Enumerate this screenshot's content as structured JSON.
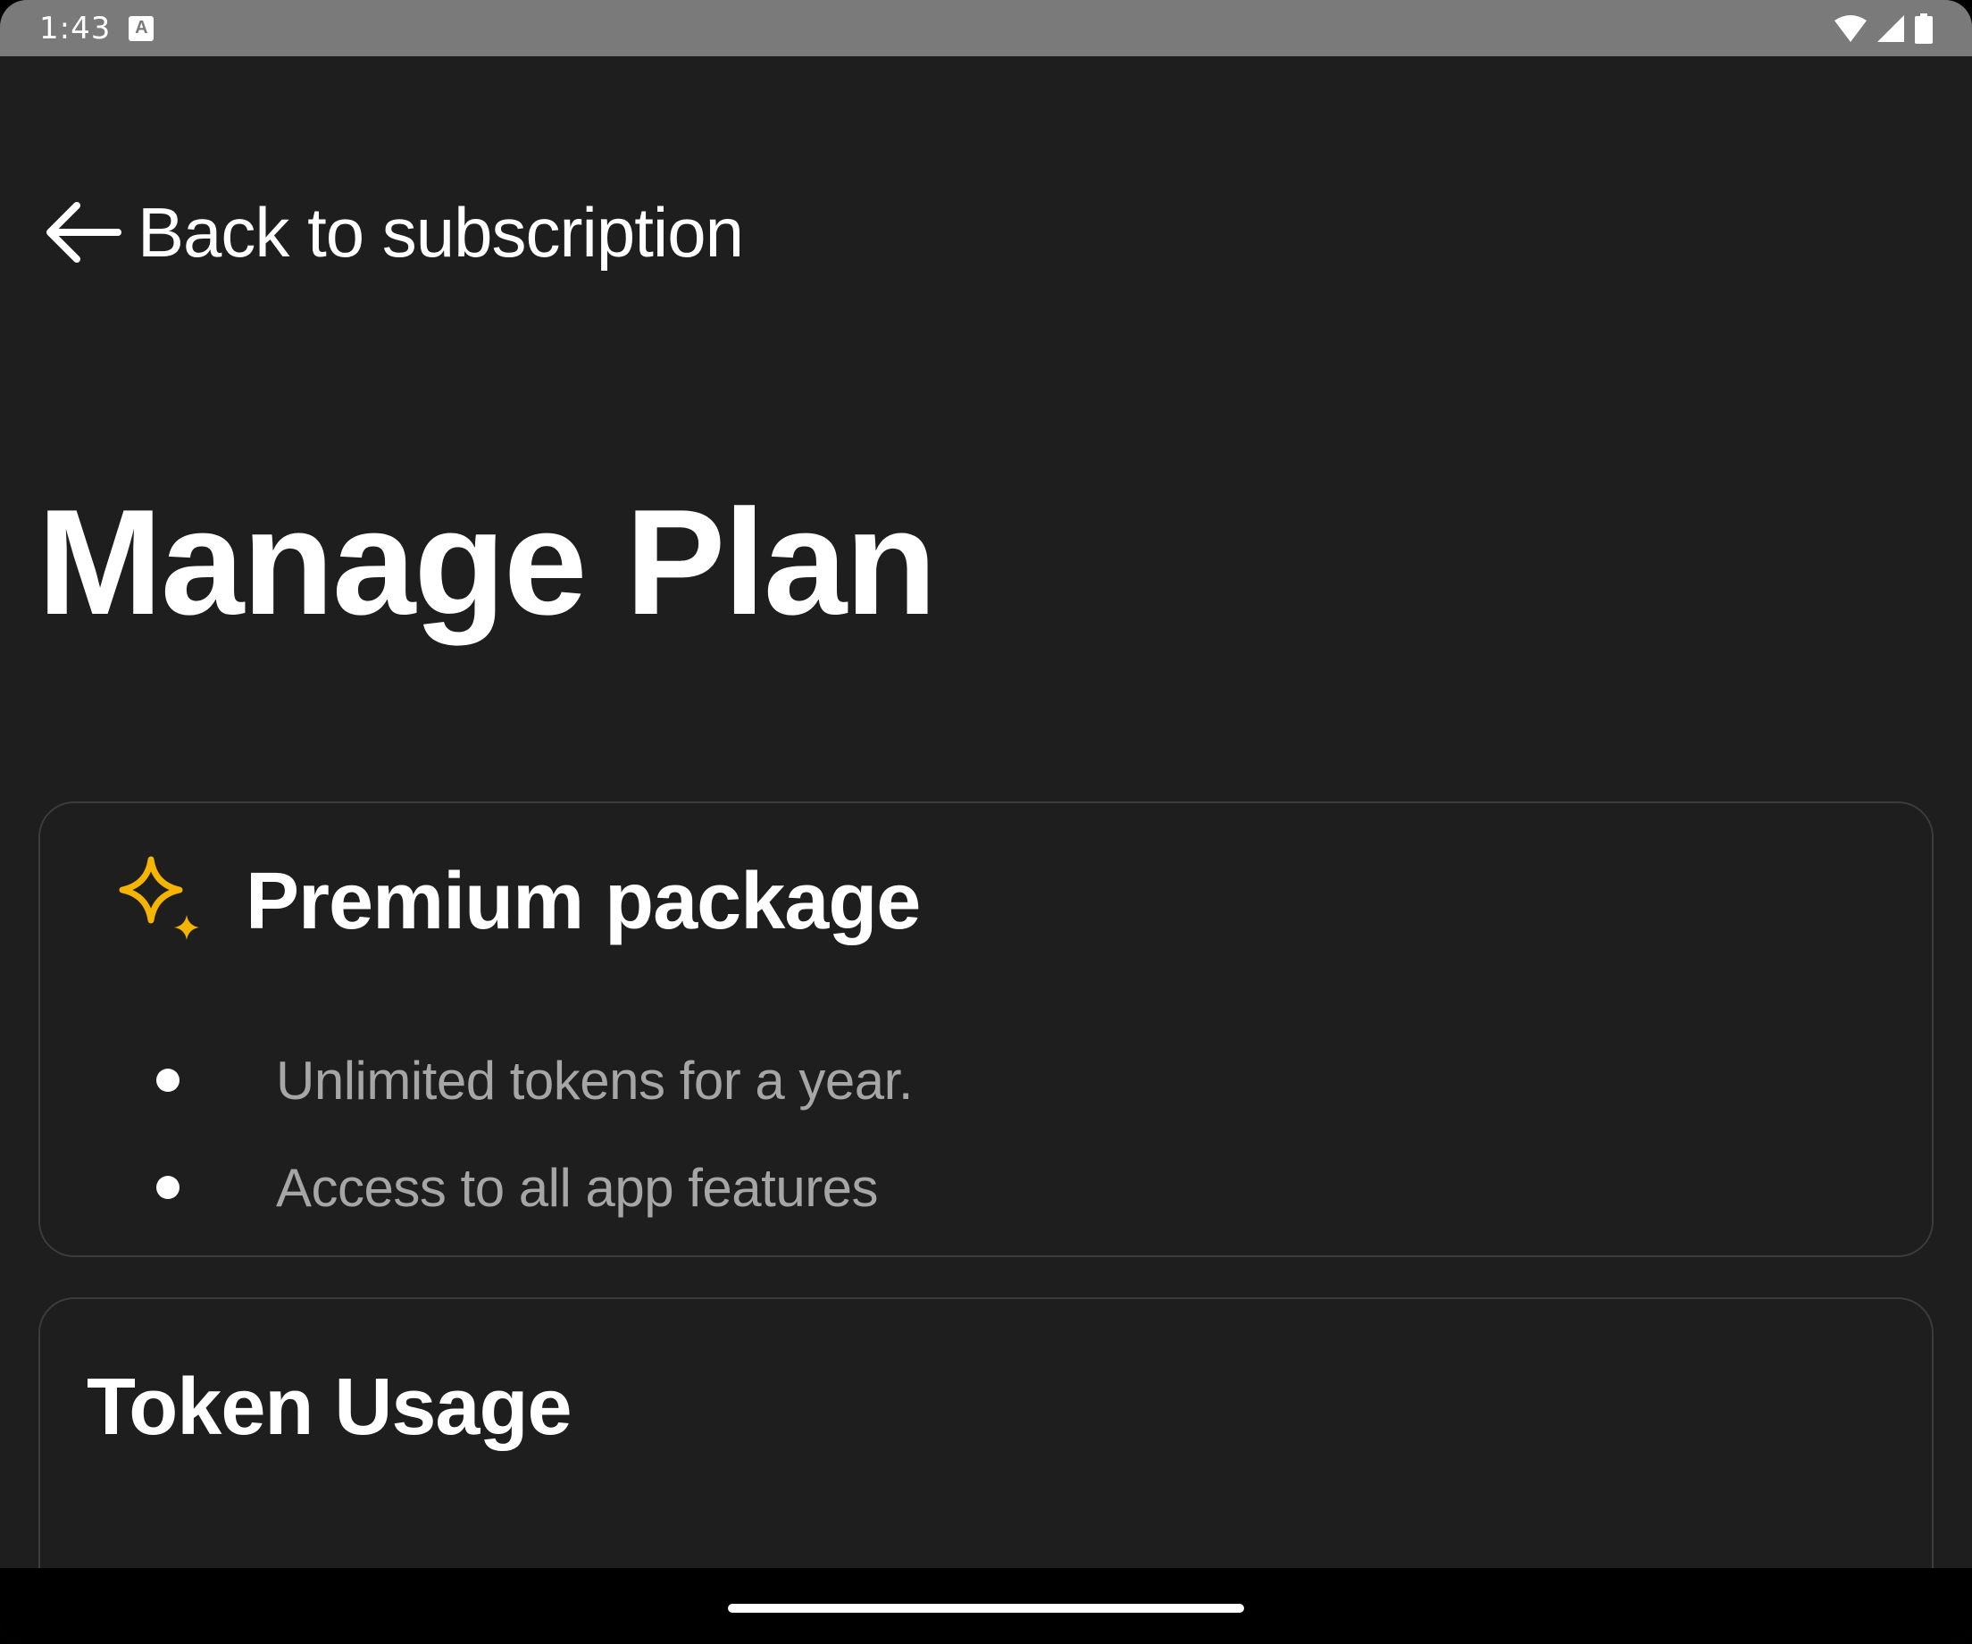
{
  "status_bar": {
    "time": "1:43",
    "notification_icon": "a-icon",
    "wifi_icon": "wifi-icon",
    "signal_icon": "cellular-signal-icon",
    "battery_icon": "battery-icon"
  },
  "header": {
    "back_icon": "arrow-left-icon",
    "back_label": "Back to subscription"
  },
  "page": {
    "title": "Manage Plan"
  },
  "premium_card": {
    "icon": "sparkle-icon",
    "icon_color": "#F4B400",
    "title": "Premium package",
    "features": [
      "Unlimited tokens for a year.",
      "Access to all app features"
    ]
  },
  "token_card": {
    "title": "Token Usage"
  },
  "colors": {
    "background": "#1e1e1e",
    "status_bar": "#7a7a7a",
    "card_border": "#3c3c3c",
    "text_primary": "#ffffff",
    "text_secondary": "#a6a6a6",
    "accent": "#F4B400"
  }
}
